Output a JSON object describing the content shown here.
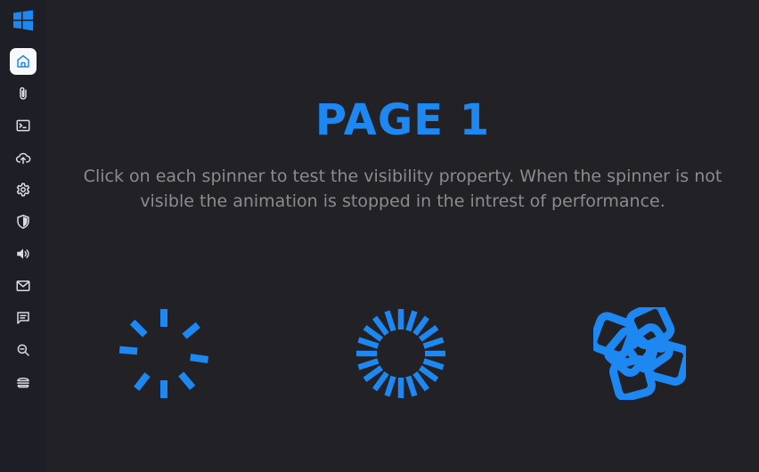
{
  "sidebar": {
    "logo": "windows-logo",
    "items": [
      {
        "id": "home",
        "icon": "home-icon",
        "active": true
      },
      {
        "id": "attachments",
        "icon": "paperclip-icon"
      },
      {
        "id": "terminal",
        "icon": "terminal-icon"
      },
      {
        "id": "cloud-upload",
        "icon": "cloud-upload-icon"
      },
      {
        "id": "settings",
        "icon": "gear-icon"
      },
      {
        "id": "security",
        "icon": "shield-icon"
      },
      {
        "id": "audio",
        "icon": "speaker-icon"
      },
      {
        "id": "mail",
        "icon": "mail-icon"
      },
      {
        "id": "messages",
        "icon": "chat-icon"
      },
      {
        "id": "search",
        "icon": "search-icon"
      },
      {
        "id": "menu",
        "icon": "burger-icon"
      }
    ]
  },
  "page": {
    "title": "PAGE 1",
    "description": "Click on each spinner to test the visibility property. When the spinner is not visible the animation is stopped in the intrest of performance."
  },
  "spinners": [
    {
      "type": "dashes"
    },
    {
      "type": "ring-bars"
    },
    {
      "type": "rotating-squares"
    }
  ],
  "colors": {
    "accent": "#1e88f2",
    "background": "#222126",
    "sidebar": "#1e1f26",
    "text_muted": "#8c8c8c",
    "icon_idle": "#d9dce3"
  }
}
